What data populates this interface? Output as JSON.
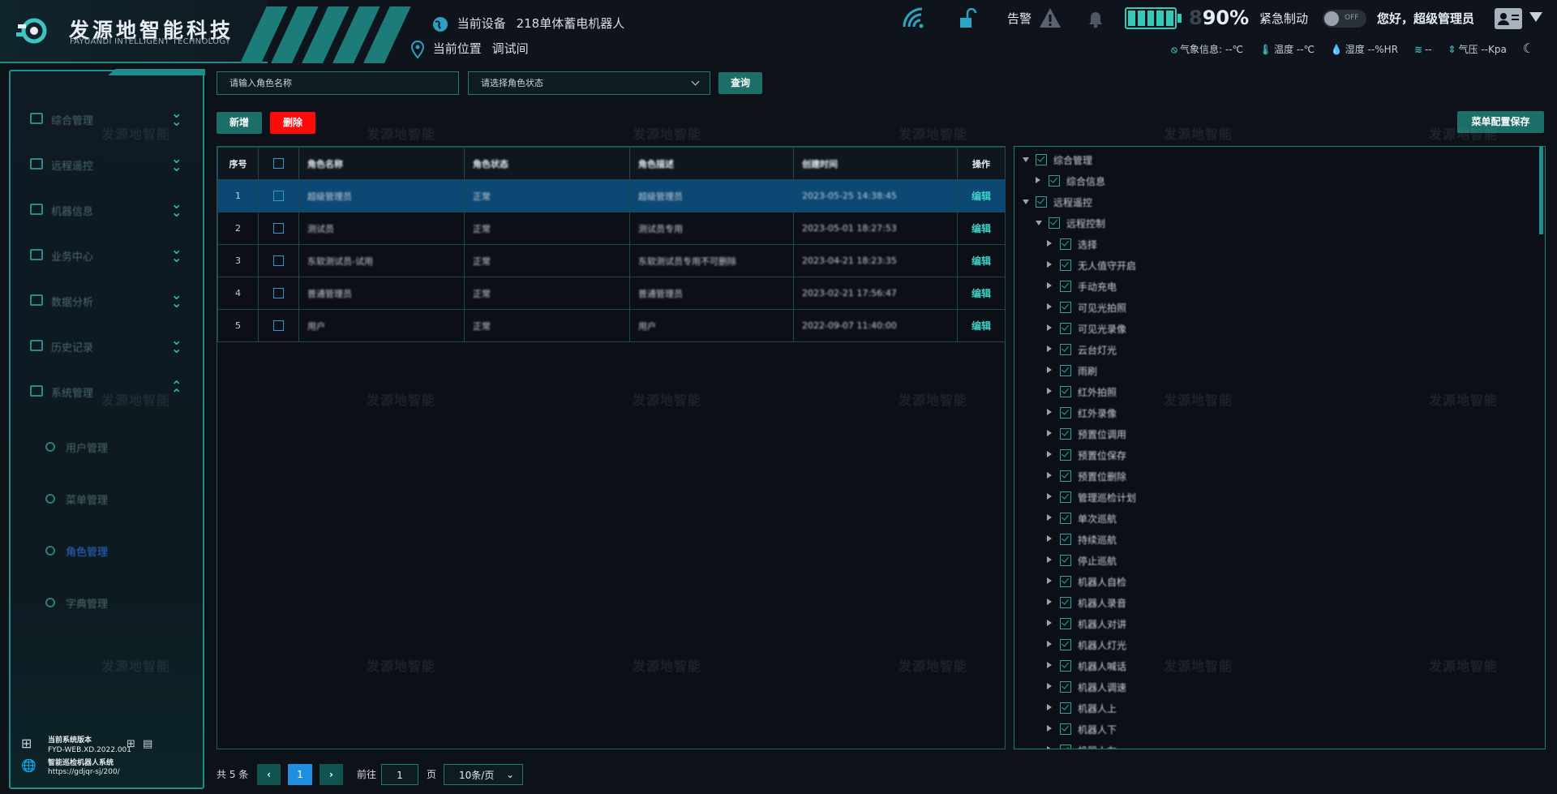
{
  "header": {
    "company_name": "发源地智能科技",
    "company_sub": "FAYUANDI INTELLIGENT TECHNOLOGY",
    "device_label": "当前设备",
    "device_value": "218单体蓄电机器人",
    "location_label": "当前位置",
    "location_value": "调试间",
    "alarm_label": "告警",
    "battery_percent": "90%",
    "battery_ghost": "8",
    "battery_level": 0.9,
    "emergency_label": "紧急制动",
    "toggle_state": "OFF",
    "greeting": "您好，超级管理员",
    "weather": {
      "info": "气象信息: --℃",
      "temperature": "温度 --℃",
      "humidity": "湿度 --%HR",
      "wind": "--",
      "pressure": "气压 --Kpa"
    },
    "icons": [
      "wifi-icon",
      "unlock-icon",
      "warning-icon",
      "bell-icon",
      "avatar-icon"
    ]
  },
  "sidebar": {
    "items": [
      {
        "label": "综合管理",
        "icon": "integrated-icon",
        "expanded": false
      },
      {
        "label": "远程遥控",
        "icon": "monitor-icon",
        "expanded": false
      },
      {
        "label": "机器信息",
        "icon": "robot-info-icon",
        "expanded": false
      },
      {
        "label": "业务中心",
        "icon": "business-icon",
        "expanded": false
      },
      {
        "label": "数据分析",
        "icon": "analytics-icon",
        "expanded": false
      },
      {
        "label": "历史记录",
        "icon": "folder-icon",
        "expanded": false
      },
      {
        "label": "系统管理",
        "icon": "system-icon",
        "expanded": true
      }
    ],
    "subitems": [
      {
        "label": "用户管理",
        "active": false
      },
      {
        "label": "菜单管理",
        "active": false
      },
      {
        "label": "角色管理",
        "active": true
      },
      {
        "label": "字典管理",
        "active": false
      }
    ],
    "system": {
      "version_label": "当前系统版本",
      "version_value": "FYD-WEB.XD.2022.001",
      "system_name": "智能巡检机器人系统",
      "url": "https://gdjqr-sj/200/"
    }
  },
  "filters": {
    "name_placeholder": "请输入角色名称",
    "status_placeholder": "请选择角色状态",
    "query_label": "查询"
  },
  "actions": {
    "add_label": "新增",
    "delete_label": "删除",
    "save_menu_label": "菜单配置保存"
  },
  "table": {
    "headers": [
      "序号",
      "",
      "角色名称",
      "角色状态",
      "角色描述",
      "创建时间",
      "操作"
    ],
    "rows": [
      {
        "index": "1",
        "name": "超级管理员",
        "status": "正常",
        "desc": "超级管理员",
        "created": "2023-05-25 14:38:45",
        "action": "编辑",
        "selected": true
      },
      {
        "index": "2",
        "name": "测试员",
        "status": "正常",
        "desc": "测试员专用",
        "created": "2023-05-01 18:27:53",
        "action": "编辑",
        "selected": false
      },
      {
        "index": "3",
        "name": "东软测试员-试用",
        "status": "正常",
        "desc": "东软测试员专用不可删除",
        "created": "2023-04-21 18:23:35",
        "action": "编辑",
        "selected": false
      },
      {
        "index": "4",
        "name": "普通管理员",
        "status": "正常",
        "desc": "普通管理员",
        "created": "2023-02-21 17:56:47",
        "action": "编辑",
        "selected": false
      },
      {
        "index": "5",
        "name": "用户",
        "status": "正常",
        "desc": "用户",
        "created": "2022-09-07 11:40:00",
        "action": "编辑",
        "selected": false
      }
    ]
  },
  "tree": {
    "nodes": [
      {
        "label": "综合管理",
        "level": 0,
        "open": true
      },
      {
        "label": "综合信息",
        "level": 1,
        "open": false
      },
      {
        "label": "远程遥控",
        "level": 0,
        "open": true
      },
      {
        "label": "远程控制",
        "level": 1,
        "open": true
      },
      {
        "label": "选择",
        "level": 2,
        "open": false
      },
      {
        "label": "无人值守开启",
        "level": 2,
        "open": false
      },
      {
        "label": "手动充电",
        "level": 2,
        "open": false
      },
      {
        "label": "可见光拍照",
        "level": 2,
        "open": false
      },
      {
        "label": "可见光录像",
        "level": 2,
        "open": false
      },
      {
        "label": "云台灯光",
        "level": 2,
        "open": false
      },
      {
        "label": "雨刷",
        "level": 2,
        "open": false
      },
      {
        "label": "红外拍照",
        "level": 2,
        "open": false
      },
      {
        "label": "红外录像",
        "level": 2,
        "open": false
      },
      {
        "label": "预置位调用",
        "level": 2,
        "open": false
      },
      {
        "label": "预置位保存",
        "level": 2,
        "open": false
      },
      {
        "label": "预置位删除",
        "level": 2,
        "open": false
      },
      {
        "label": "管理巡检计划",
        "level": 2,
        "open": false
      },
      {
        "label": "单次巡航",
        "level": 2,
        "open": false
      },
      {
        "label": "持续巡航",
        "level": 2,
        "open": false
      },
      {
        "label": "停止巡航",
        "level": 2,
        "open": false
      },
      {
        "label": "机器人自检",
        "level": 2,
        "open": false
      },
      {
        "label": "机器人录音",
        "level": 2,
        "open": false
      },
      {
        "label": "机器人对讲",
        "level": 2,
        "open": false
      },
      {
        "label": "机器人灯光",
        "level": 2,
        "open": false
      },
      {
        "label": "机器人喊话",
        "level": 2,
        "open": false
      },
      {
        "label": "机器人调速",
        "level": 2,
        "open": false
      },
      {
        "label": "机器人上",
        "level": 2,
        "open": false
      },
      {
        "label": "机器人下",
        "level": 2,
        "open": false
      },
      {
        "label": "机器人左",
        "level": 2,
        "open": false
      }
    ]
  },
  "pagination": {
    "total_label": "共 5 条",
    "current_page": "1",
    "goto_label": "前往",
    "goto_value": "1",
    "page_unit": "页",
    "page_size": "10条/页"
  },
  "watermark_text": "发源地智能",
  "colors": {
    "accent": "#1b8f8b",
    "selected_row": "#0b4873",
    "delete": "#ff0a0a",
    "link": "#3ed0c6",
    "current_page": "#1f8ee0"
  }
}
